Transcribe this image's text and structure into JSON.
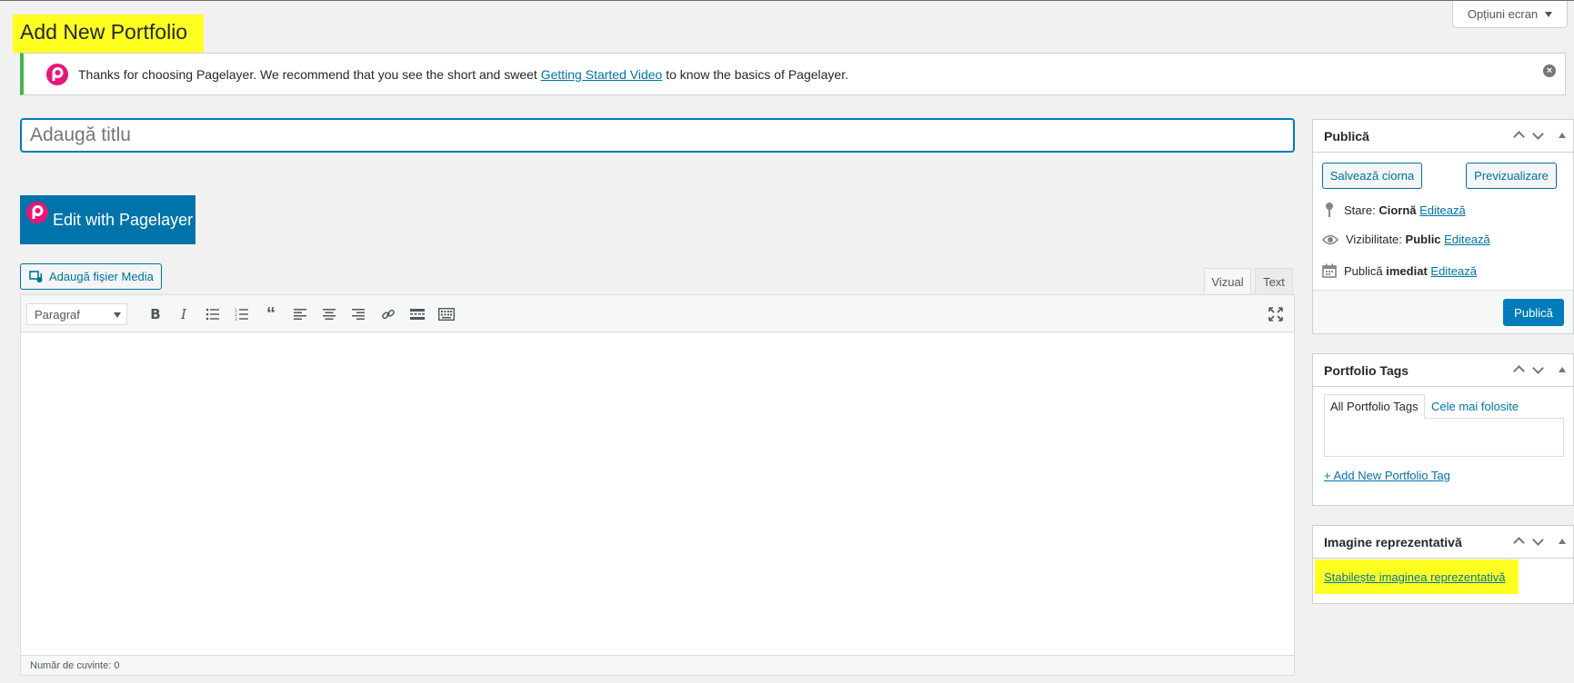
{
  "header": {
    "page_title": "Add New Portfolio",
    "screen_options": "Opțiuni ecran",
    "highlight_color": "#ffff22"
  },
  "notice": {
    "text_before": "Thanks for choosing Pagelayer. We recommend that you see the short and sweet ",
    "link_text": "Getting Started Video",
    "text_after": " to know the basics of Pagelayer.",
    "dismiss_icon": "dismiss-icon"
  },
  "title_input": {
    "placeholder": "Adaugă titlu",
    "value": ""
  },
  "pagelayer": {
    "button_label": "Edit with Pagelayer",
    "logo_icon": "pagelayer-logo-icon",
    "brand_color": "#e6177a"
  },
  "editor": {
    "add_media_label": "Adaugă fișier Media",
    "tabs": {
      "visual": "Vizual",
      "text": "Text"
    },
    "format_select": "Paragraf",
    "toolbar_icons": [
      "bold-icon",
      "italic-icon",
      "bullet-list-icon",
      "numbered-list-icon",
      "blockquote-icon",
      "align-left-icon",
      "align-center-icon",
      "align-right-icon",
      "link-icon",
      "read-more-icon",
      "toolbar-toggle-icon",
      "fullscreen-icon"
    ],
    "word_count": "Număr de cuvinte: 0"
  },
  "publish_box": {
    "title": "Publică",
    "save_draft": "Salvează ciorna",
    "preview": "Previzualizare",
    "status_label": "Stare:",
    "status_value": "Ciornă",
    "visibility_label": "Vizibilitate:",
    "visibility_value": "Public",
    "publish_label": "Publică",
    "publish_value": "imediat",
    "edit_link": "Editează",
    "publish_button": "Publică",
    "accent_color": "#007cba"
  },
  "tags_box": {
    "title": "Portfolio Tags",
    "tab_all": "All Portfolio Tags",
    "tab_popular": "Cele mai folosite",
    "add_link": "+ Add New Portfolio Tag"
  },
  "featured_box": {
    "title": "Imagine reprezentativă",
    "set_link": "Stabilește imaginea reprezentativă"
  },
  "notice_border_color": "#46b450"
}
